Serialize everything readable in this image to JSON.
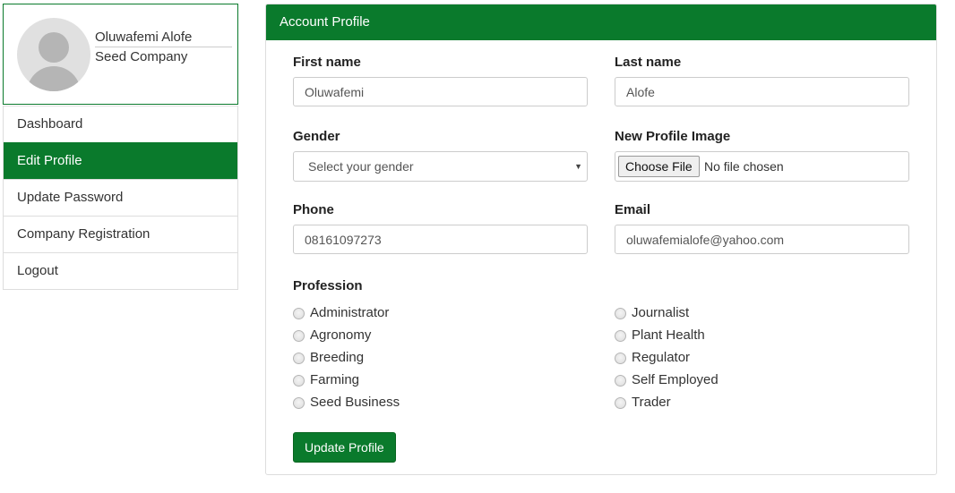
{
  "user": {
    "name": "Oluwafemi Alofe",
    "company": "Seed Company"
  },
  "menu": {
    "items": [
      {
        "label": "Dashboard",
        "active": false
      },
      {
        "label": "Edit Profile",
        "active": true
      },
      {
        "label": "Update Password",
        "active": false
      },
      {
        "label": "Company Registration",
        "active": false
      },
      {
        "label": "Logout",
        "active": false
      }
    ]
  },
  "panel": {
    "title": "Account Profile",
    "first_name": {
      "label": "First name",
      "value": "Oluwafemi"
    },
    "last_name": {
      "label": "Last name",
      "value": "Alofe"
    },
    "gender": {
      "label": "Gender",
      "selected": "Select your gender"
    },
    "profile_image": {
      "label": "New Profile Image",
      "button": "Choose File",
      "status": "No file chosen"
    },
    "phone": {
      "label": "Phone",
      "value": "08161097273"
    },
    "email": {
      "label": "Email",
      "value": "oluwafemialofe@yahoo.com"
    },
    "profession": {
      "label": "Profession",
      "left": [
        "Administrator",
        "Agronomy",
        "Breeding",
        "Farming",
        "Seed Business"
      ],
      "right": [
        "Journalist",
        "Plant Health",
        "Regulator",
        "Self Employed",
        "Trader"
      ]
    },
    "submit_label": "Update Profile"
  },
  "colors": {
    "brand_green": "#0a7a2c",
    "border": "#dddddd"
  }
}
